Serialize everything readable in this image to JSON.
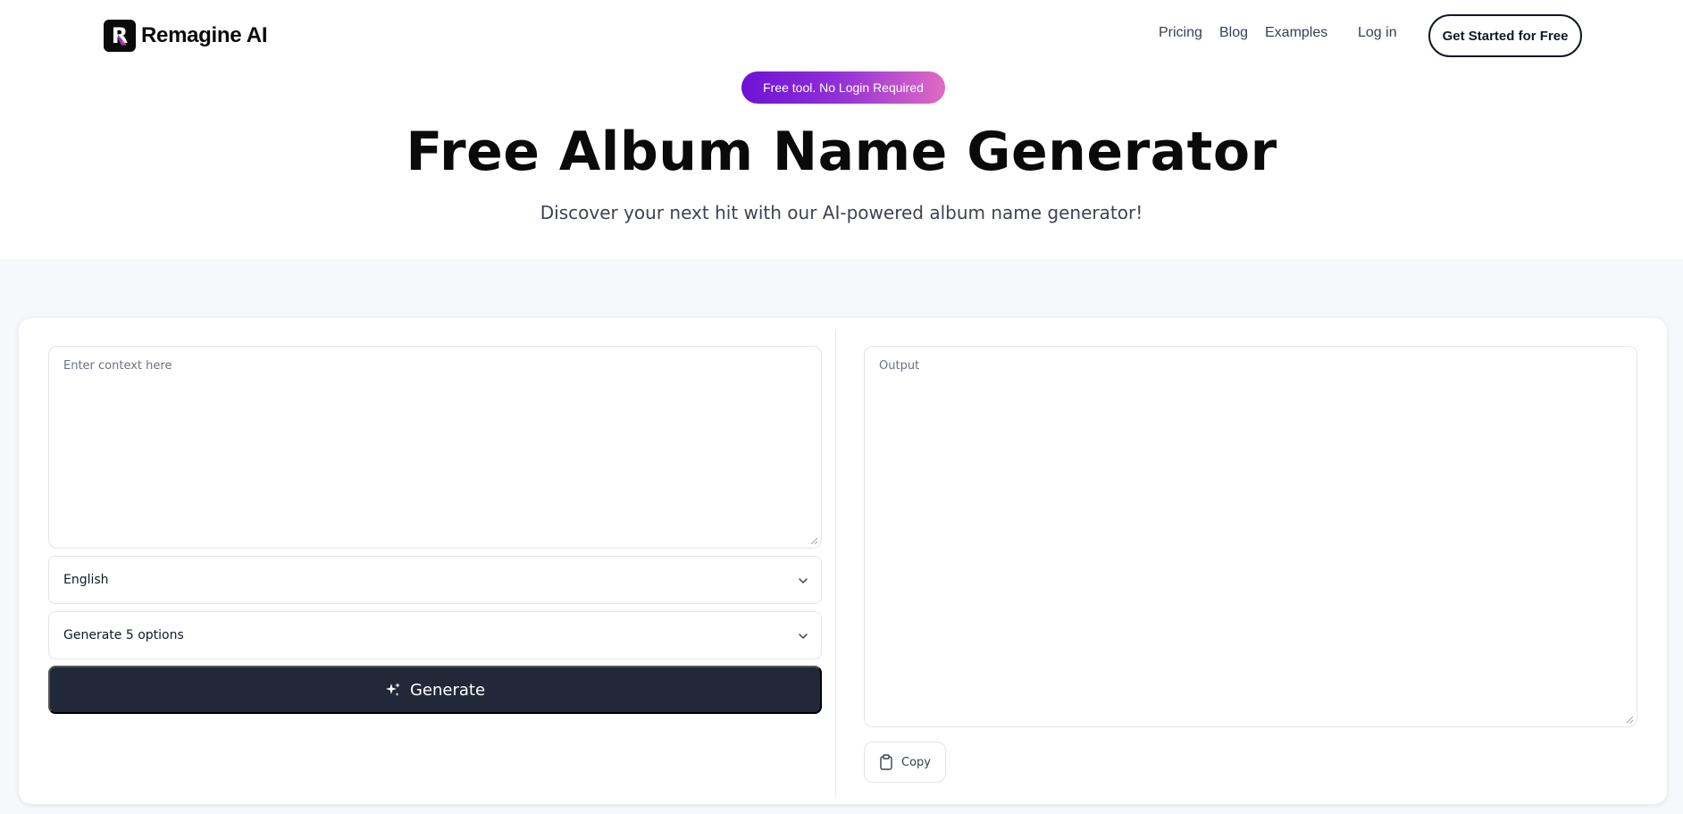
{
  "brand": {
    "name": "Remagine AI",
    "logo_letter": "R"
  },
  "nav": {
    "links": [
      "Pricing",
      "Blog",
      "Examples",
      "Log in"
    ],
    "cta": "Get Started for Free"
  },
  "hero": {
    "badge": "Free tool. No Login Required",
    "title": "Free Album Name Generator",
    "subtitle": "Discover your next hit with our AI-powered album name generator!"
  },
  "tool": {
    "context_input": {
      "placeholder": "Enter context here",
      "value": ""
    },
    "language_select": {
      "selected": "English"
    },
    "options_select": {
      "selected": "Generate 5 options"
    },
    "generate_label": "Generate",
    "output": {
      "placeholder": "Output",
      "value": ""
    },
    "copy_label": "Copy"
  },
  "colors": {
    "primary_button": "#212838",
    "badge_gradient_start": "#6d12d6",
    "badge_gradient_end": "#e16ac4",
    "section_background": "#f7f8fb"
  },
  "icons": [
    "sparkle-icon",
    "chevron-down-icon",
    "clipboard-icon"
  ]
}
